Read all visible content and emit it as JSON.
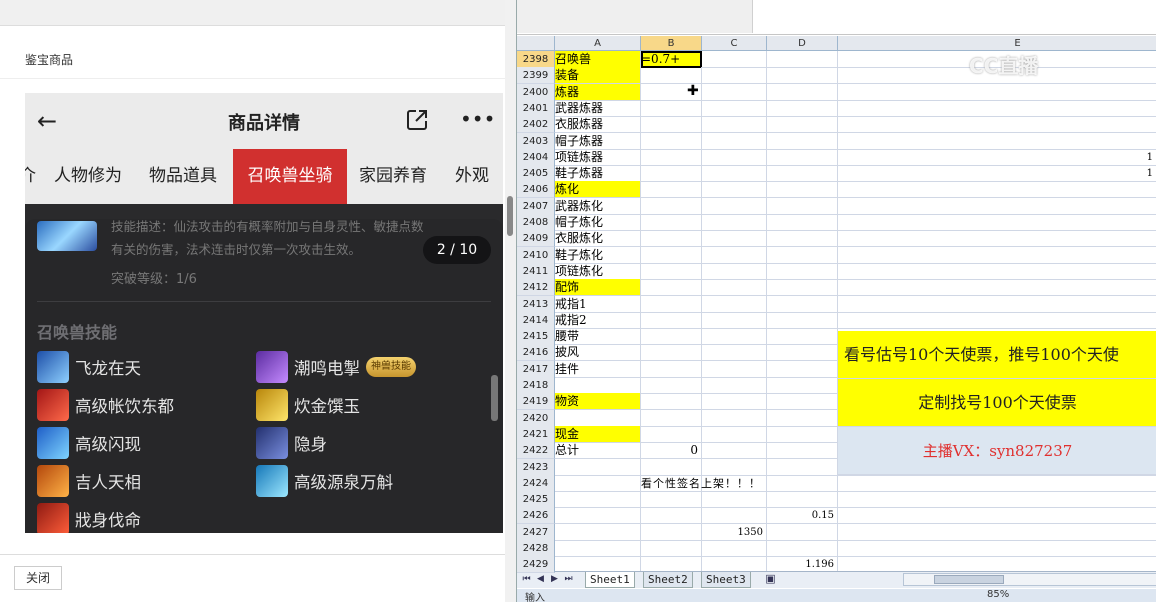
{
  "left_pane": {
    "title": "鉴宝商品",
    "close_label": "关闭"
  },
  "phone": {
    "nav_title": "商品详情",
    "tabs": [
      {
        "label": "介"
      },
      {
        "label": "人物修为"
      },
      {
        "label": "物品道具"
      },
      {
        "label": "召唤兽坐骑"
      },
      {
        "label": "家园养育"
      },
      {
        "label": "外观"
      }
    ],
    "skill_desc": "技能描述：仙法攻击的有概率附加与自身灵性、敏捷点数有关的伤害，法术连击时仅第一次攻击生效。",
    "pager": "2 / 10",
    "breakthrough": "突破等级：1/6",
    "skills_heading": "召唤兽技能",
    "skills": [
      {
        "name": "飞龙在天"
      },
      {
        "name": "潮鸣电掣",
        "badge": "神兽技能"
      },
      {
        "name": "高级帐饮东都"
      },
      {
        "name": "炊金馔玉"
      },
      {
        "name": "高级闪现"
      },
      {
        "name": "隐身"
      },
      {
        "name": "吉人天相"
      },
      {
        "name": "高级源泉万斛"
      },
      {
        "name": "戕身伐命"
      }
    ],
    "colors": {
      "tab_active": "#d1302f",
      "card_bg": "#272729"
    }
  },
  "excel": {
    "columns": [
      "A",
      "B",
      "C",
      "D",
      "E"
    ],
    "selected_column": "B",
    "selected_row": "2398",
    "rows": [
      {
        "n": "2398",
        "a": "召唤兽",
        "b": "=0.7+",
        "a_yellow": true,
        "b_yellow": true
      },
      {
        "n": "2399",
        "a": "装备",
        "a_yellow": true
      },
      {
        "n": "2400",
        "a": "炼器",
        "a_yellow": true
      },
      {
        "n": "2401",
        "a": "武器炼器"
      },
      {
        "n": "2402",
        "a": "衣服炼器"
      },
      {
        "n": "2403",
        "a": "帽子炼器"
      },
      {
        "n": "2404",
        "a": "项链炼器",
        "e": "1"
      },
      {
        "n": "2405",
        "a": "鞋子炼器",
        "e": "1"
      },
      {
        "n": "2406",
        "a": "炼化",
        "a_yellow": true
      },
      {
        "n": "2407",
        "a": "武器炼化"
      },
      {
        "n": "2408",
        "a": "帽子炼化"
      },
      {
        "n": "2409",
        "a": "衣服炼化"
      },
      {
        "n": "2410",
        "a": "鞋子炼化"
      },
      {
        "n": "2411",
        "a": "项链炼化"
      },
      {
        "n": "2412",
        "a": "配饰",
        "a_yellow": true
      },
      {
        "n": "2413",
        "a": "戒指1"
      },
      {
        "n": "2414",
        "a": "戒指2"
      },
      {
        "n": "2415",
        "a": "腰带"
      },
      {
        "n": "2416",
        "a": "披风"
      },
      {
        "n": "2417",
        "a": "挂件"
      },
      {
        "n": "2418",
        "a": ""
      },
      {
        "n": "2419",
        "a": "物资",
        "a_yellow": true
      },
      {
        "n": "2420",
        "a": ""
      },
      {
        "n": "2421",
        "a": "现金",
        "a_yellow": true
      },
      {
        "n": "2422",
        "a": "总计",
        "b": "0"
      },
      {
        "n": "2423",
        "a": ""
      },
      {
        "n": "2424",
        "a": "",
        "b": "看个性签名上架！！！"
      },
      {
        "n": "2425",
        "a": ""
      },
      {
        "n": "2426",
        "a": "",
        "d": "0.15"
      },
      {
        "n": "2427",
        "a": "",
        "c": "1350"
      },
      {
        "n": "2428",
        "a": ""
      },
      {
        "n": "2429",
        "a": "",
        "d": "1.196"
      }
    ],
    "banner1": "看号估号10个天使票，推号100个天使",
    "banner2": "定制找号100个天使票",
    "banner3": "主播VX：syn827237",
    "sheets": [
      "Sheet1",
      "Sheet2",
      "Sheet3"
    ],
    "status_mode": "输入",
    "zoom": "85%",
    "watermark": "CC直播",
    "colors": {
      "yellow": "#ffff00",
      "banner3_bg": "#dce6f1",
      "banner3_text": "#e0302f"
    }
  }
}
